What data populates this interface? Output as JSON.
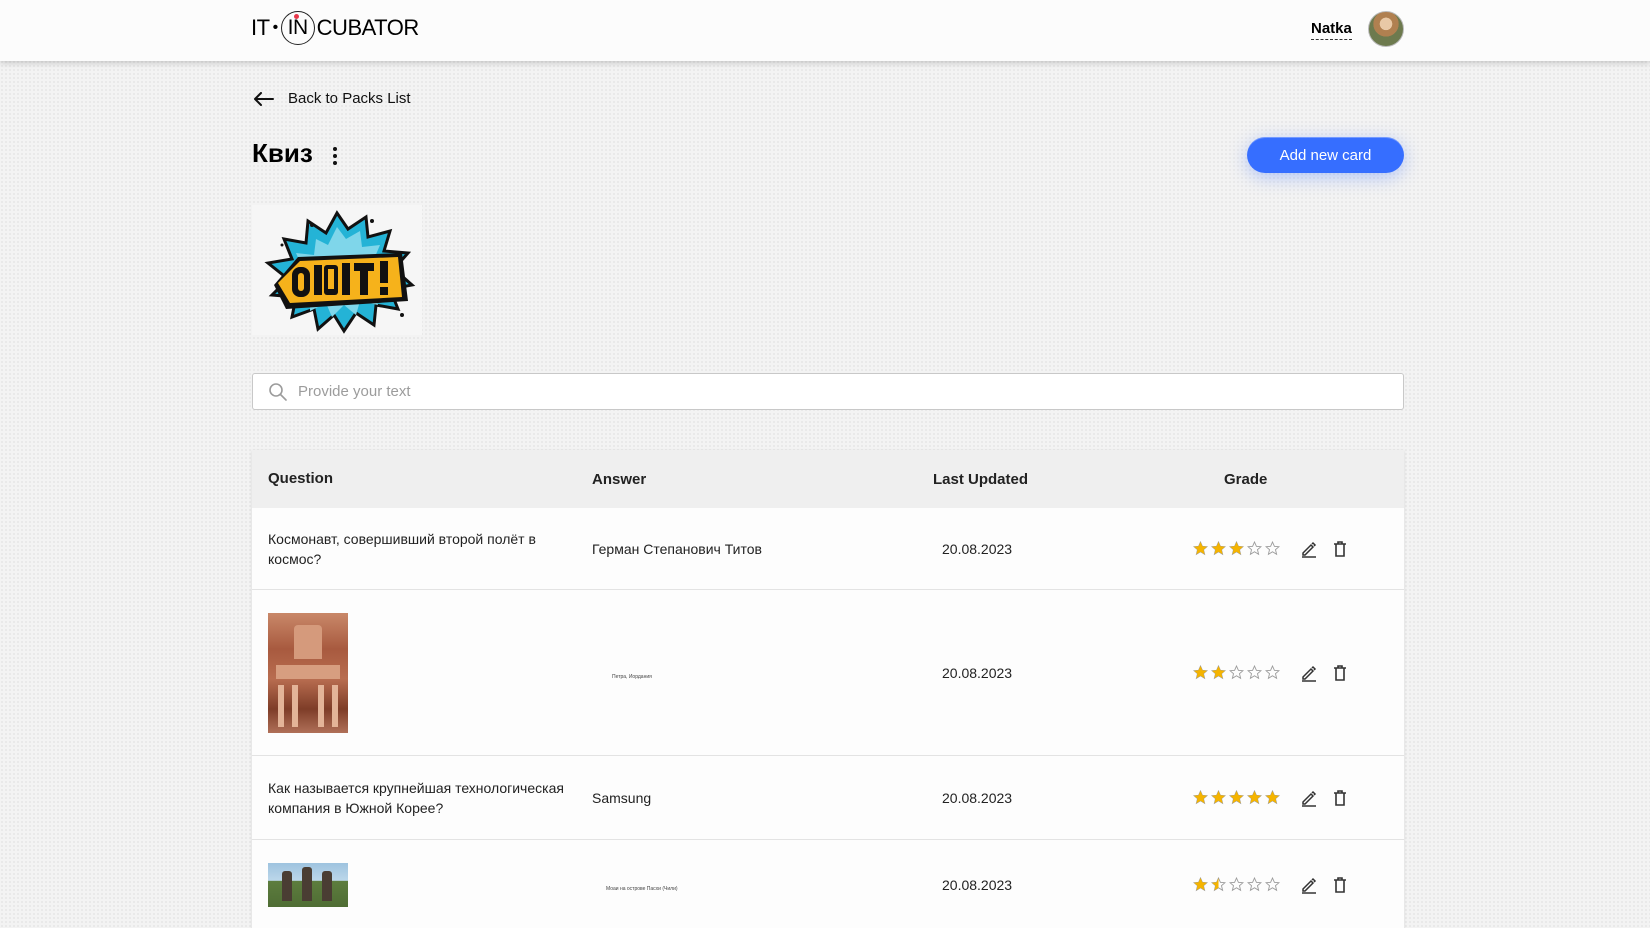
{
  "header": {
    "logo": {
      "part1": "IT",
      "sep": "•",
      "part2": "IN",
      "part3": "CUBATOR"
    },
    "user_name": "Natka"
  },
  "nav": {
    "back_label": "Back to Packs List"
  },
  "pack": {
    "title": "Квиз",
    "add_button": "Add new card"
  },
  "search": {
    "placeholder": "Provide your text",
    "value": ""
  },
  "table": {
    "columns": [
      "Question",
      "Answer",
      "Last Updated",
      "Grade"
    ],
    "rows": [
      {
        "question": "Космонавт, совершивший второй полёт в космос?",
        "answer": "Герман Степанович Титов",
        "updated": "20.08.2023",
        "grade": 3
      },
      {
        "question": "",
        "answer": "Петра, Иордания",
        "updated": "20.08.2023",
        "grade": 2
      },
      {
        "question": "Как называется крупнейшая технологическая компания в Южной Корее?",
        "answer": "Samsung",
        "updated": "20.08.2023",
        "grade": 5
      },
      {
        "question": "",
        "answer": "Моаи на острове Пасхи (Чили)",
        "updated": "20.08.2023",
        "grade": 1.5
      }
    ]
  },
  "colors": {
    "accent": "#366eff",
    "star": "#f5b400",
    "star_empty": "#9a9a9a"
  },
  "icons": {
    "back": "arrow-left-icon",
    "menu": "kebab-icon",
    "search": "search-icon",
    "edit": "pencil-icon",
    "delete": "trash-icon",
    "star": "star-icon"
  }
}
